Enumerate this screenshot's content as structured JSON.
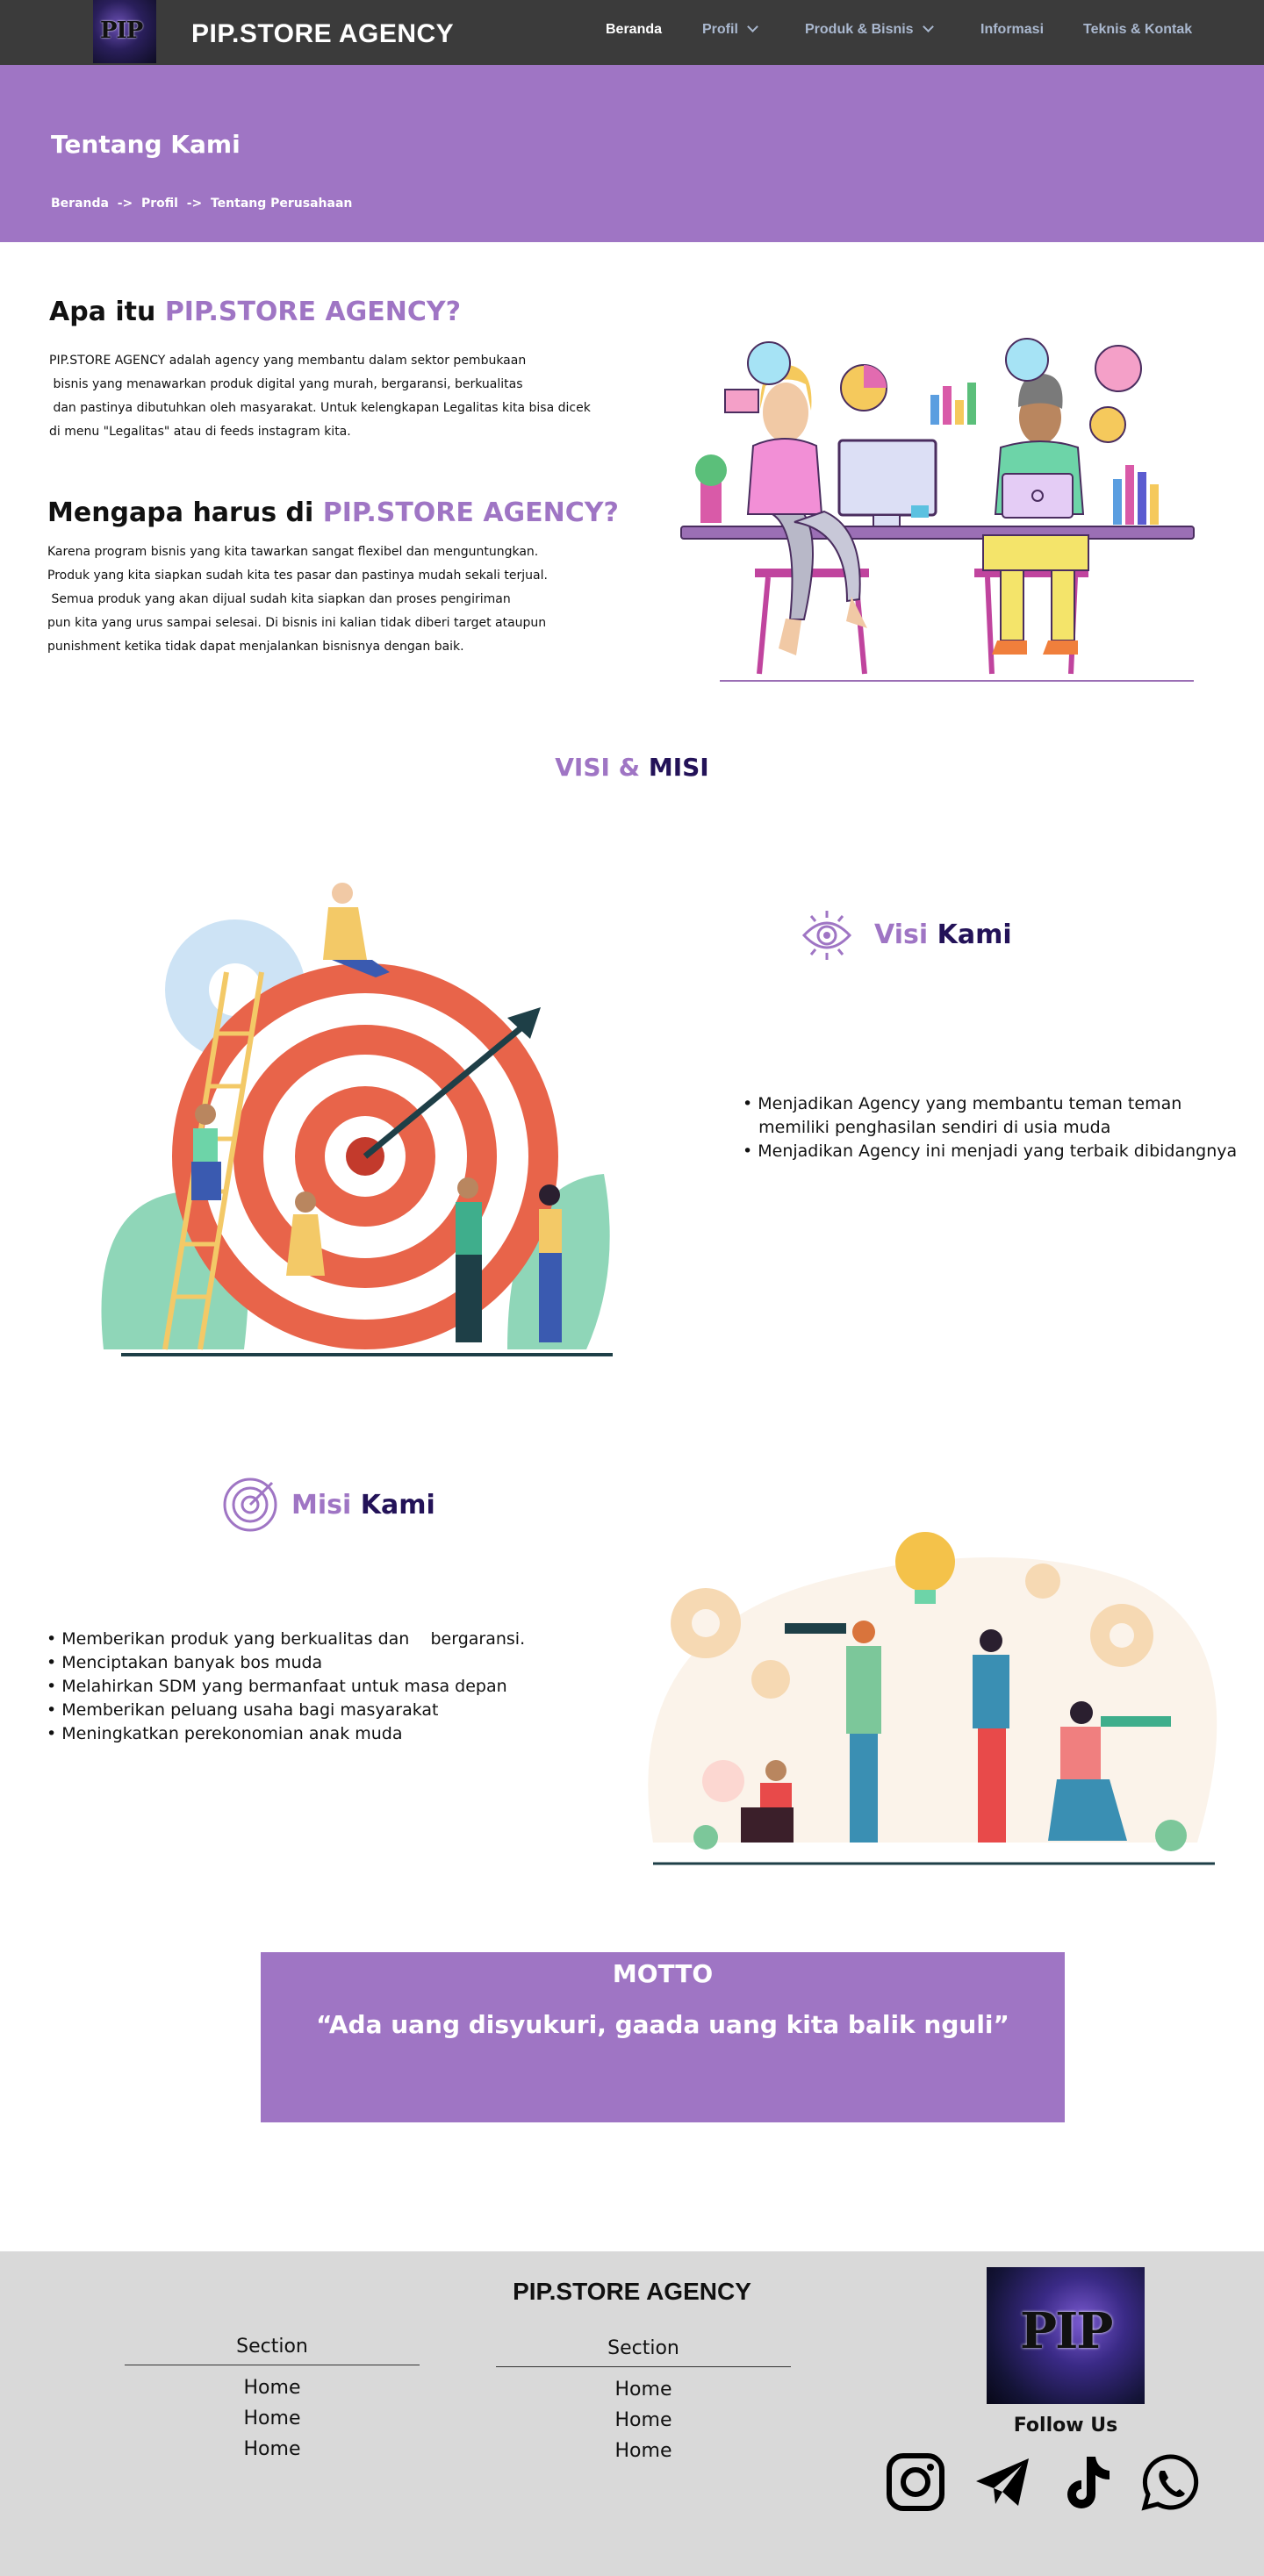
{
  "nav": {
    "brand": "PIP.STORE AGENCY",
    "logo_text": "PIP",
    "links": [
      {
        "label": "Beranda"
      },
      {
        "label": "Profil"
      },
      {
        "label": "Produk & Bisnis"
      },
      {
        "label": "Informasi"
      },
      {
        "label": "Teknis & Kontak"
      }
    ]
  },
  "hero": {
    "title": "Tentang Kami",
    "breadcrumb": "Beranda  ->  Profil  ->  Tentang Perusahaan"
  },
  "about": {
    "heading_prefix": "Apa itu ",
    "heading_accent": "PIP.STORE AGENCY?",
    "lines": [
      "PIP.STORE AGENCY adalah agency yang membantu dalam sektor pembukaan",
      " bisnis yang menawarkan produk digital yang murah, bergaransi, berkualitas",
      " dan pastinya dibutuhkan oleh masyarakat. Untuk kelengkapan Legalitas kita bisa dicek",
      "di menu \"Legalitas\" atau di feeds instagram kita."
    ]
  },
  "why": {
    "heading_prefix": "Mengapa harus di ",
    "heading_accent": "PIP.STORE AGENCY?",
    "lines": [
      "Karena program bisnis yang kita tawarkan sangat flexibel dan menguntungkan.",
      "Produk yang kita siapkan sudah kita tes pasar dan pastinya mudah sekali terjual.",
      " Semua produk yang akan dijual sudah kita siapkan dan proses pengiriman",
      "pun kita yang urus sampai selesai. Di bisnis ini kalian tidak diberi target ataupun",
      "punishment ketika tidak dapat menjalankan bisnisnya dengan baik."
    ]
  },
  "visi_misi": {
    "title_a": "VISI &",
    "title_b": "MISI",
    "visi": {
      "title_a": "Visi",
      "title_b": "Kami",
      "items": [
        "• Menjadikan Agency yang membantu teman teman",
        "   memiliki penghasilan sendiri di usia muda",
        "• Menjadikan Agency ini menjadi yang terbaik dibidangnya"
      ]
    },
    "misi": {
      "title_a": "Misi",
      "title_b": "Kami",
      "items": [
        "• Memberikan produk yang berkualitas dan    bergaransi.",
        "• Menciptakan banyak bos muda",
        "• Melahirkan SDM yang bermanfaat untuk masa depan",
        "• Memberikan peluang usaha bagi masyarakat",
        "• Meningkatkan perekonomian anak muda"
      ]
    }
  },
  "motto": {
    "title": "MOTTO",
    "text": "“Ada uang disyukuri, gaada uang kita balik nguli”"
  },
  "footer": {
    "brand": "PIP.STORE AGENCY",
    "logo_text": "PIP",
    "columns": [
      {
        "section": "Section",
        "links": [
          "Home",
          "Home",
          "Home"
        ]
      },
      {
        "section": "Section",
        "links": [
          "Home",
          "Home",
          "Home"
        ]
      }
    ],
    "follow": "Follow Us",
    "social_icons": [
      "instagram-icon",
      "telegram-icon",
      "tiktok-icon",
      "whatsapp-icon"
    ]
  },
  "colors": {
    "accent": "#9f75c4",
    "dark_purple": "#231258",
    "nav_bg": "#3b3b3b",
    "footer_bg": "#d9d9d9"
  }
}
